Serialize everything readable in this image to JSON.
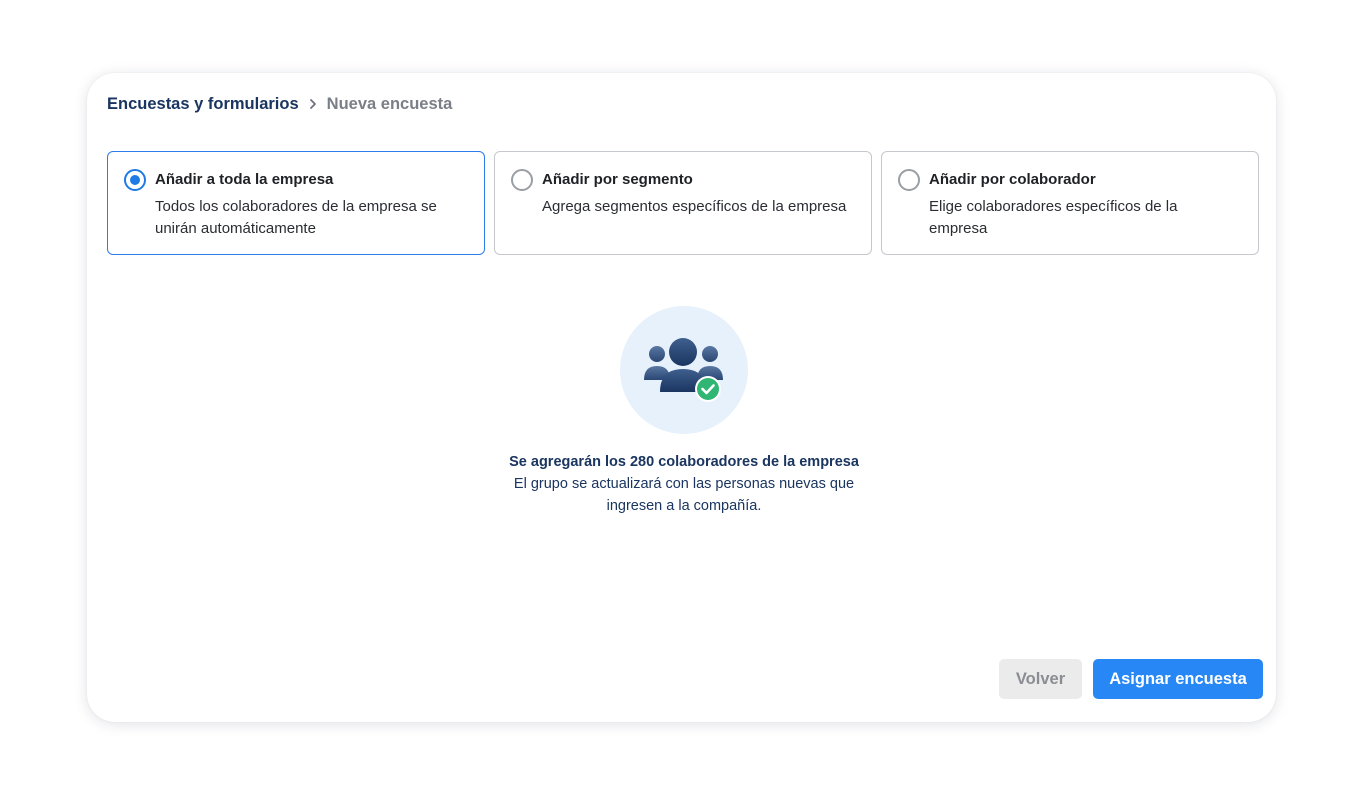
{
  "breadcrumb": {
    "root": "Encuestas y formularios",
    "separator_icon": "chevron-right-icon",
    "current": "Nueva encuesta"
  },
  "options": [
    {
      "title": "Añadir a toda la empresa",
      "description": "Todos los colaboradores de la empresa se unirán automáticamente",
      "selected": true
    },
    {
      "title": "Añadir por segmento",
      "description": "Agrega segmentos específicos de la empresa",
      "selected": false
    },
    {
      "title": "Añadir por colaborador",
      "description": "Elige colaboradores específicos de la empresa",
      "selected": false
    }
  ],
  "illustration": {
    "icon": "group-check-icon"
  },
  "info": {
    "title": "Se agregarán los 280 colaboradores de la empresa",
    "subtitle": "El grupo se actualizará con las personas nuevas que ingresen a la compañía."
  },
  "actions": {
    "back_label": "Volver",
    "primary_label": "Asignar encuesta"
  },
  "colors": {
    "primary": "#2687f5",
    "selected_border": "#2b7de9",
    "navy": "#1a3560",
    "check_badge": "#2fb673",
    "illustration_bg": "#e6f1fc"
  }
}
